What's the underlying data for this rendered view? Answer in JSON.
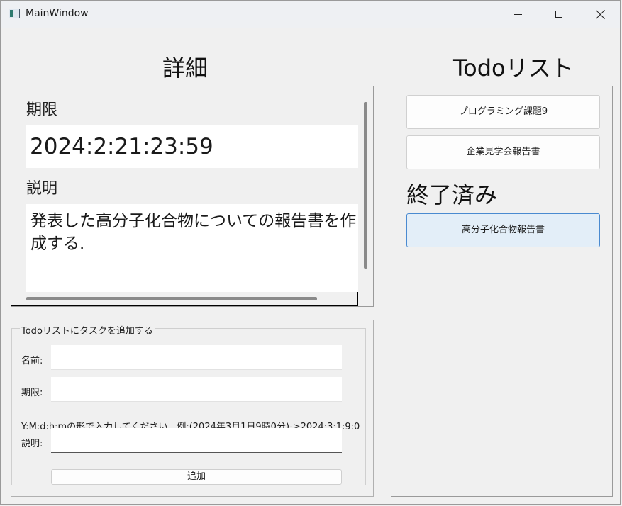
{
  "window": {
    "title": "MainWindow"
  },
  "detail": {
    "heading": "詳細",
    "deadline_label": "期限",
    "deadline_value": "2024:2:21:23:59",
    "description_label": "説明",
    "description_value": "発表した高分子化合物についての報告書を作成する."
  },
  "add_task": {
    "group_title": "Todoリストにタスクを追加する",
    "name_label": "名前:",
    "name_value": "",
    "deadline_label": "期限:",
    "deadline_value": "",
    "hint": "Y:M:d:h:mの形で入力してください．例:(2024年3月1日9時0分)->2024:3:1:9:0",
    "description_label": "説明:",
    "description_value": "",
    "add_button": "追加"
  },
  "todo": {
    "heading": "Todoリスト",
    "items": [
      {
        "label": "プログラミング課題9"
      },
      {
        "label": "企業見学会報告書"
      }
    ],
    "done_heading": "終了済み",
    "done_items": [
      {
        "label": "高分子化合物報告書"
      }
    ]
  }
}
